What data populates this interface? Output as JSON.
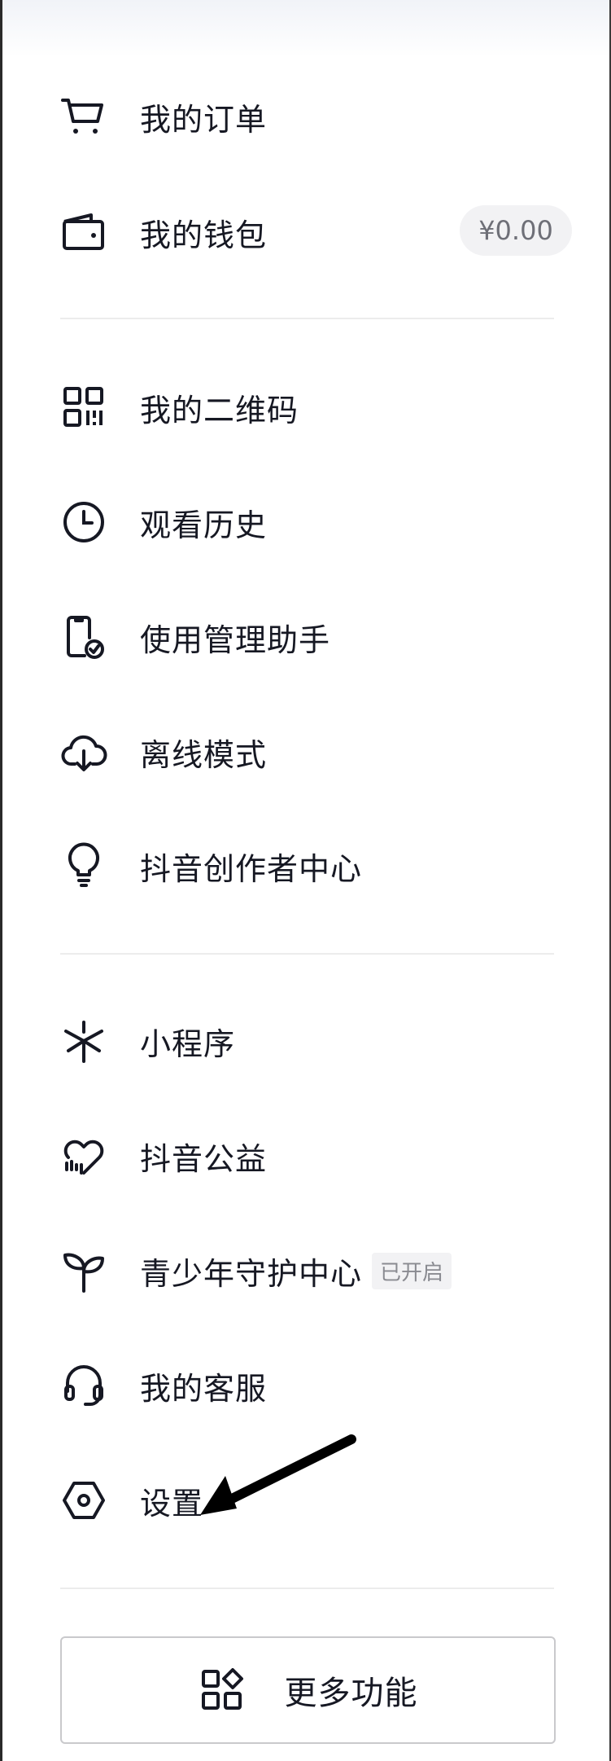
{
  "menu": {
    "orders": {
      "label": "我的订单",
      "icon": "cart-icon"
    },
    "wallet": {
      "label": "我的钱包",
      "icon": "wallet-icon",
      "balance": "¥0.00"
    },
    "qrcode": {
      "label": "我的二维码",
      "icon": "qrcode-icon"
    },
    "history": {
      "label": "观看历史",
      "icon": "clock-icon"
    },
    "usage": {
      "label": "使用管理助手",
      "icon": "phone-check-icon"
    },
    "offline": {
      "label": "离线模式",
      "icon": "cloud-download-icon"
    },
    "creator": {
      "label": "抖音创作者中心",
      "icon": "lightbulb-icon"
    },
    "miniapp": {
      "label": "小程序",
      "icon": "asterisk-icon"
    },
    "charity": {
      "label": "抖音公益",
      "icon": "heart-icon"
    },
    "youth": {
      "label": "青少年守护中心",
      "icon": "sprout-icon",
      "status_tag": "已开启"
    },
    "service": {
      "label": "我的客服",
      "icon": "headset-icon"
    },
    "settings": {
      "label": "设置",
      "icon": "settings-hex-icon"
    }
  },
  "more_button": {
    "label": "更多功能",
    "icon": "apps-grid-icon"
  },
  "colors": {
    "text": "#161823",
    "divider": "#ececec",
    "badge_bg": "#f2f2f4",
    "annotation_arrow": "#000000"
  }
}
